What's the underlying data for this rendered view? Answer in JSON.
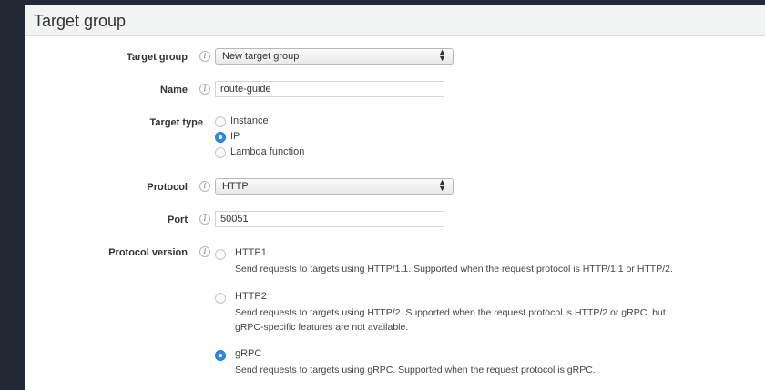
{
  "panel": {
    "title": "Target group"
  },
  "fields": {
    "target_group": {
      "label": "Target group",
      "value": "New target group"
    },
    "name": {
      "label": "Name",
      "value": "route-guide"
    },
    "target_type": {
      "label": "Target type",
      "options": [
        "Instance",
        "IP",
        "Lambda function"
      ],
      "selected": "IP"
    },
    "protocol": {
      "label": "Protocol",
      "value": "HTTP"
    },
    "port": {
      "label": "Port",
      "value": "50051"
    },
    "protocol_version": {
      "label": "Protocol version",
      "selected": "gRPC",
      "options": [
        {
          "label": "HTTP1",
          "desc": [
            "Send requests to targets using HTTP/1.1. Supported when the request protocol is HTTP/1.1 or HTTP/2."
          ]
        },
        {
          "label": "HTTP2",
          "desc": [
            "Send requests to targets using HTTP/2. Supported when the request protocol is HTTP/2 or gRPC, but",
            "gRPC-specific features are not available."
          ]
        },
        {
          "label": "gRPC",
          "desc": [
            "Send requests to targets using gRPC. Supported when the request protocol is gRPC."
          ]
        }
      ]
    }
  },
  "icons": {
    "info": "i",
    "select_arrows": "▲▼"
  },
  "colors": {
    "accent": "#2b8be6",
    "background": "#232a35"
  }
}
